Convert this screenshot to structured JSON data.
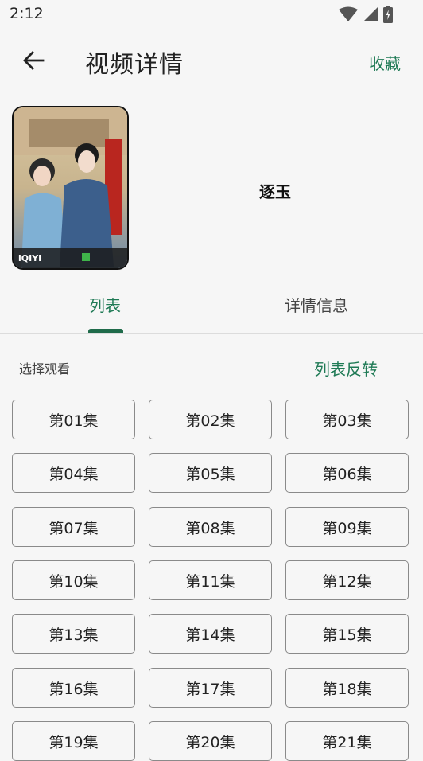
{
  "status": {
    "time": "2:12"
  },
  "app_bar": {
    "title": "视频详情",
    "favorite_label": "收藏"
  },
  "video": {
    "title": "逐玉"
  },
  "tabs": [
    {
      "label": "列表"
    },
    {
      "label": "详情信息"
    }
  ],
  "episodes_section": {
    "label": "选择观看",
    "reverse_label": "列表反转"
  },
  "episodes": [
    "第01集",
    "第02集",
    "第03集",
    "第04集",
    "第05集",
    "第06集",
    "第07集",
    "第08集",
    "第09集",
    "第10集",
    "第11集",
    "第12集",
    "第13集",
    "第14集",
    "第15集",
    "第16集",
    "第17集",
    "第18集",
    "第19集",
    "第20集",
    "第21集"
  ],
  "colors": {
    "accent": "#1f7a55",
    "indicator": "#1f6b4a",
    "background": "#f6f6f6"
  }
}
